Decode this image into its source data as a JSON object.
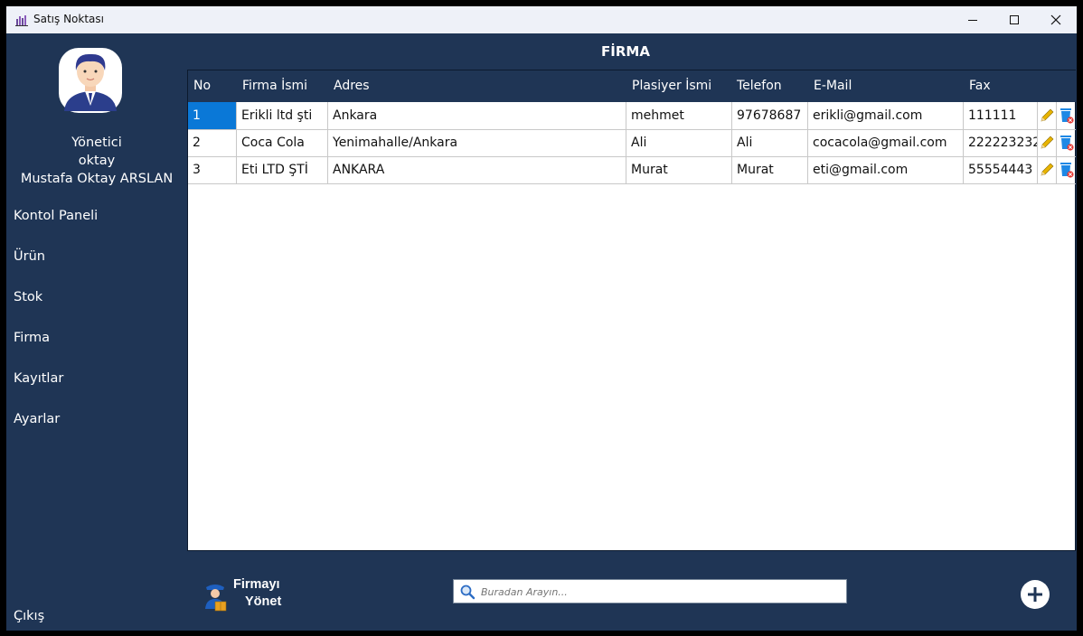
{
  "window": {
    "title": "Satış Noktası"
  },
  "sidebar": {
    "role": "Yönetici",
    "username": "oktay",
    "fullname": "Mustafa Oktay ARSLAN",
    "items": [
      {
        "label": "Kontol Paneli"
      },
      {
        "label": "Ürün"
      },
      {
        "label": "Stok"
      },
      {
        "label": "Firma"
      },
      {
        "label": "Kayıtlar"
      },
      {
        "label": "Ayarlar"
      }
    ],
    "logout": "Çıkış"
  },
  "main": {
    "title": "FİRMA",
    "columns": [
      "No",
      "Firma İsmi",
      "Adres",
      "Plasiyer İsmi",
      "Telefon",
      "E-Mail",
      "Fax"
    ],
    "rows": [
      {
        "no": "1",
        "firma": "Erikli ltd şti",
        "adres": "Ankara",
        "plasiyer": "mehmet",
        "telefon": "97678687",
        "email": "erikli@gmail.com",
        "fax": "111111"
      },
      {
        "no": "2",
        "firma": "Coca Cola",
        "adres": "Yenimahalle/Ankara",
        "plasiyer": "Ali",
        "telefon": "Ali",
        "email": "cocacola@gmail.com",
        "fax": "222223232"
      },
      {
        "no": "3",
        "firma": "Eti LTD ŞTİ",
        "adres": "ANKARA",
        "plasiyer": "Murat",
        "telefon": "Murat",
        "email": "eti@gmail.com",
        "fax": "55554443"
      }
    ],
    "row_icons": {
      "edit": "pencil-icon",
      "delete": "trash-icon"
    }
  },
  "footer": {
    "manage_line1": "Firmayı",
    "manage_line2": "Yönet",
    "search_placeholder": "Buradan Arayın...",
    "add_icon": "plus-icon"
  },
  "colors": {
    "background": "#1f3555",
    "selection": "#0a78d7",
    "accent_yellow": "#e8b400",
    "accent_blue": "#1e88e5"
  }
}
